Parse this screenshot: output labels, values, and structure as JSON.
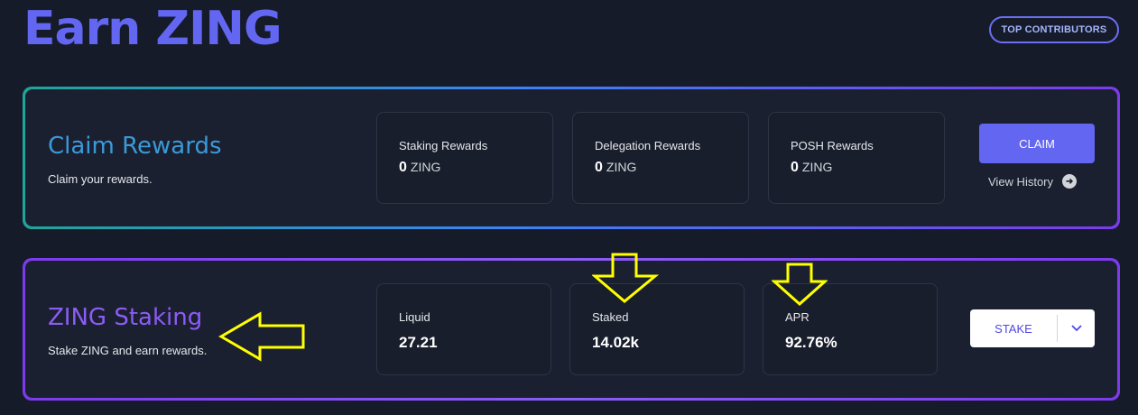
{
  "page": {
    "title": "Earn ZING",
    "top_contributors": "TOP CONTRIBUTORS"
  },
  "claim": {
    "title": "Claim Rewards",
    "subtitle": "Claim your rewards.",
    "stats": [
      {
        "label": "Staking Rewards",
        "value": "0",
        "unit": "ZING"
      },
      {
        "label": "Delegation Rewards",
        "value": "0",
        "unit": "ZING"
      },
      {
        "label": "POSH Rewards",
        "value": "0",
        "unit": "ZING"
      }
    ],
    "claim_label": "CLAIM",
    "history_label": "View History",
    "history_icon": "arrow-right-circle-icon"
  },
  "staking": {
    "title": "ZING Staking",
    "subtitle": "Stake ZING and earn rewards.",
    "stats": [
      {
        "label": "Liquid",
        "value": "27.21"
      },
      {
        "label": "Staked",
        "value": "14.02k"
      },
      {
        "label": "APR",
        "value": "92.76%"
      }
    ],
    "stake_label": "STAKE",
    "dropdown_icon": "chevron-down-icon"
  },
  "annotations": {
    "color": "#ffff00",
    "icons": [
      "arrow-left-icon",
      "arrow-down-icon",
      "arrow-down-icon"
    ]
  },
  "colors": {
    "accent": "#6366f1",
    "claim_title": "#3a9ad9",
    "staking_title": "#8b5cf6",
    "background": "#161b2a"
  }
}
